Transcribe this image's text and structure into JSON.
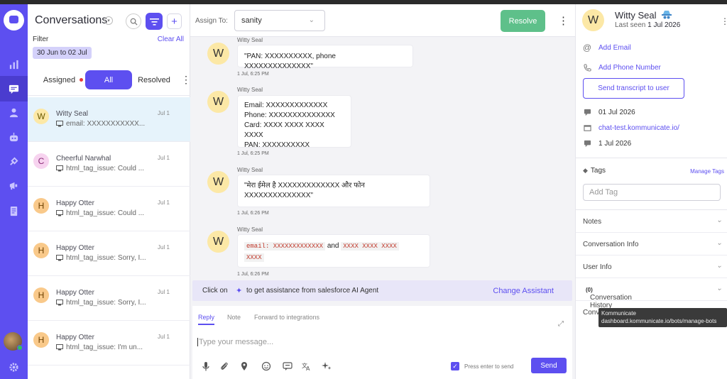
{
  "sidebar": {
    "items": [
      "logo-icon",
      "analytics-icon",
      "conversations-icon",
      "contacts-icon",
      "bot-icon",
      "integrations-icon",
      "campaigns-icon",
      "reports-icon"
    ]
  },
  "list": {
    "title": "Conversations",
    "filter_label": "Filter",
    "clear_label": "Clear All",
    "date_chip": "30 Jun to 02 Jul",
    "tabs": {
      "assigned": "Assigned",
      "all": "All",
      "resolved": "Resolved"
    },
    "conversations": [
      {
        "initial": "W",
        "name": "Witty Seal",
        "time": "Jul 1",
        "preview": "email: XXXXXXXXXXX...",
        "bg": "#fce8a6",
        "fg": "#6b5a00"
      },
      {
        "initial": "C",
        "name": "Cheerful Narwhal",
        "time": "Jul 1",
        "preview": "html_tag_issue: Could ...",
        "bg": "#f7d3ef",
        "fg": "#8a2a78"
      },
      {
        "initial": "H",
        "name": "Happy Otter",
        "time": "Jul 1",
        "preview": "html_tag_issue: Could ...",
        "bg": "#f9c98a",
        "fg": "#6b3f00"
      },
      {
        "initial": "H",
        "name": "Happy Otter",
        "time": "Jul 1",
        "preview": "html_tag_issue: Sorry, I...",
        "bg": "#f9c98a",
        "fg": "#6b3f00"
      },
      {
        "initial": "H",
        "name": "Happy Otter",
        "time": "Jul 1",
        "preview": "html_tag_issue: Sorry, I...",
        "bg": "#f9c98a",
        "fg": "#6b3f00"
      },
      {
        "initial": "H",
        "name": "Happy Otter",
        "time": "Jul 1",
        "preview": "html_tag_issue: I'm un...",
        "bg": "#f9c98a",
        "fg": "#6b3f00"
      }
    ]
  },
  "header": {
    "assign_label": "Assign To:",
    "assignee": "sanity",
    "resolve_label": "Resolve"
  },
  "messages": [
    {
      "avatar": "W",
      "sender": "Witty Seal",
      "lines": [
        "\"PAN: XXXXXXXXXX, phone XXXXXXXXXXXXXX\""
      ],
      "time": "1 Jul, 6:25 PM"
    },
    {
      "avatar": "W",
      "sender": "Witty Seal",
      "lines": [
        "Email: XXXXXXXXXXXXX",
        "Phone: XXXXXXXXXXXXXX",
        "Card: XXXX XXXX XXXX XXXX",
        "PAN: XXXXXXXXXX"
      ],
      "time": "1 Jul, 6:25 PM"
    },
    {
      "avatar": "W",
      "sender": "Witty Seal",
      "lines": [
        "\"मेरा ईमेल है XXXXXXXXXXXXX और फोन",
        "XXXXXXXXXXXXXX\""
      ],
      "time": "1 Jul, 6:26 PM"
    },
    {
      "avatar": "W",
      "sender": "Witty Seal",
      "code_1": "email: XXXXXXXXXXXXX",
      "joiner": "and",
      "code_2": "XXXX XXXX XXXX",
      "code_3": "XXXX",
      "time": "1 Jul, 6:26 PM"
    }
  ],
  "assistant_bar": {
    "prefix": "Click on",
    "suffix": "to get assistance from salesforce AI Agent",
    "change_label": "Change Assistant"
  },
  "composer": {
    "tabs": [
      "Reply",
      "Note",
      "Forward to integrations"
    ],
    "placeholder": "Type your message...",
    "press_enter_label": "Press enter to send",
    "send_label": "Send"
  },
  "contact": {
    "avatar": "W",
    "name": "Witty Seal",
    "last_seen_prefix": "Last seen",
    "last_seen_date": "1 Jul 2026",
    "add_email": "Add Email",
    "add_phone": "Add Phone Number",
    "transcript_button": "Send transcript to user",
    "created_date": "01 Jul 2026",
    "source_url": "chat-test.kommunicate.io/",
    "last_message_date": "1 Jul 2026",
    "tags_label": "Tags",
    "manage_tags": "Manage Tags",
    "add_tag_placeholder": "Add Tag",
    "sections": {
      "notes": "Notes",
      "conversation_info": "Conversation Info",
      "user_info": "User Info",
      "conversation_history": "Conversation History",
      "history_count": "(0)",
      "conv_truncated": "Conv"
    }
  },
  "tooltip": {
    "line1": "Kommunicate",
    "line2": "dashboard.kommunicate.io/bots/manage-bots"
  },
  "colors": {
    "brand": "#5d4ff0",
    "resolve": "#5ec08a",
    "selected_row": "#e6f3fb"
  }
}
